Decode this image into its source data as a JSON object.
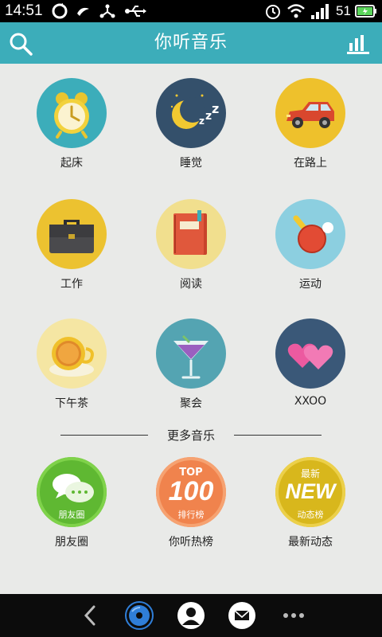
{
  "status_bar": {
    "time": "14:51",
    "battery_level": "51"
  },
  "header": {
    "title": "你听音乐"
  },
  "scenes": [
    {
      "label": "起床",
      "icon": "alarm-clock-icon"
    },
    {
      "label": "睡觉",
      "icon": "moon-sleep-icon"
    },
    {
      "label": "在路上",
      "icon": "car-icon"
    },
    {
      "label": "工作",
      "icon": "briefcase-icon"
    },
    {
      "label": "阅读",
      "icon": "book-icon"
    },
    {
      "label": "运动",
      "icon": "ping-pong-icon"
    },
    {
      "label": "下午茶",
      "icon": "tea-cup-icon"
    },
    {
      "label": "聚会",
      "icon": "cocktail-icon"
    },
    {
      "label": "XXOO",
      "icon": "hearts-icon"
    }
  ],
  "more_section": {
    "title": "更多音乐",
    "items": [
      {
        "label": "朋友圈",
        "badge": "朋友圈",
        "icon": "chat-bubbles-icon"
      },
      {
        "label": "你听热榜",
        "badge_top": "TOP",
        "badge_main": "100",
        "badge": "排行榜",
        "icon": "top100-icon"
      },
      {
        "label": "最新动态",
        "badge_top": "最新",
        "badge_main": "NEW",
        "badge": "动态榜",
        "icon": "new-icon"
      }
    ]
  },
  "colors": {
    "header": "#3cadba",
    "background": "#e9eae8",
    "navbar": "#0c0c0c"
  }
}
